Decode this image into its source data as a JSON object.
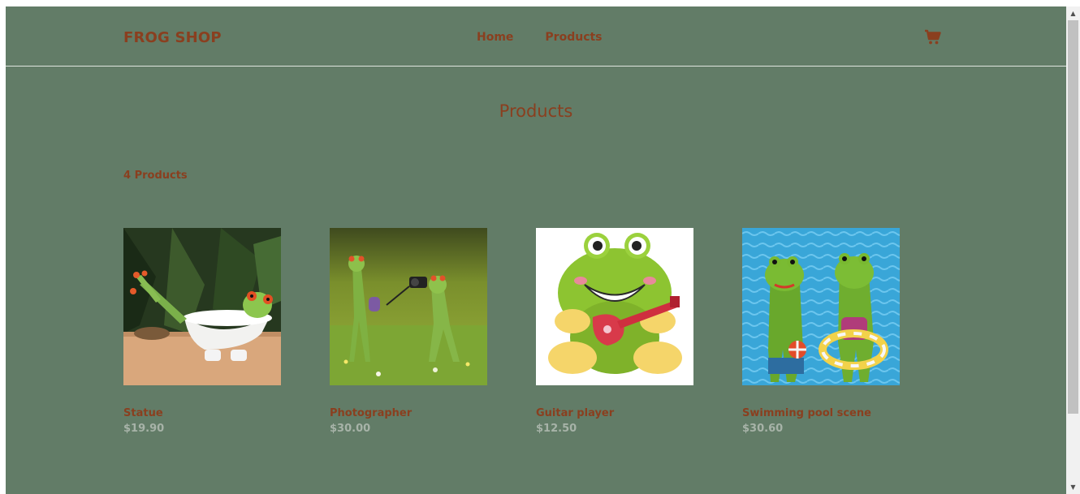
{
  "header": {
    "brand": "FROG SHOP",
    "nav": [
      {
        "label": "Home"
      },
      {
        "label": "Products"
      }
    ],
    "cart_icon": "shopping-cart-icon"
  },
  "main": {
    "title": "Products",
    "count_label": "4 Products",
    "products": [
      {
        "name": "Statue",
        "price": "$19.90"
      },
      {
        "name": "Photographer",
        "price": "$30.00"
      },
      {
        "name": "Guitar player",
        "price": "$12.50"
      },
      {
        "name": "Swimming pool scene",
        "price": "$30.60"
      }
    ]
  },
  "colors": {
    "background": "#627c67",
    "accent": "#8a3f1f",
    "price": "#a7b3a8"
  }
}
